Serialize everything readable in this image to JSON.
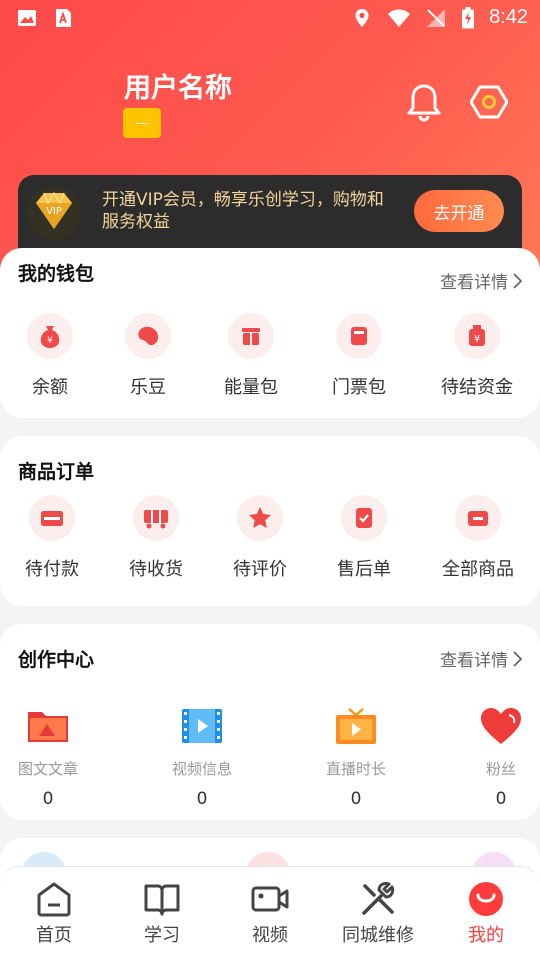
{
  "status_bar": {
    "time": "8:42"
  },
  "profile": {
    "username": "用户名称",
    "badge": "---"
  },
  "vip": {
    "gem_text": "VIP",
    "description": "开通VIP会员，畅享乐创学习，购物和服务权益",
    "button": "去开通"
  },
  "wallet": {
    "title": "我的钱包",
    "detail": "查看详情",
    "items": [
      {
        "label": "余额",
        "icon": "money-bag-icon"
      },
      {
        "label": "乐豆",
        "icon": "bean-icon"
      },
      {
        "label": "能量包",
        "icon": "gift-box-icon"
      },
      {
        "label": "门票包",
        "icon": "ticket-icon"
      },
      {
        "label": "待结资金",
        "icon": "pending-funds-icon"
      }
    ]
  },
  "orders": {
    "title": "商品订单",
    "items": [
      {
        "label": "待付款",
        "icon": "card-icon"
      },
      {
        "label": "待收货",
        "icon": "truck-icon"
      },
      {
        "label": "待评价",
        "icon": "star-icon"
      },
      {
        "label": "售后单",
        "icon": "shield-icon"
      },
      {
        "label": "全部商品",
        "icon": "wallet-icon"
      }
    ]
  },
  "creation": {
    "title": "创作中心",
    "detail": "查看详情",
    "items": [
      {
        "label": "图文文章",
        "count": "0",
        "icon": "folder-icon"
      },
      {
        "label": "视频信息",
        "count": "0",
        "icon": "film-icon"
      },
      {
        "label": "直播时长",
        "count": "0",
        "icon": "tv-icon"
      },
      {
        "label": "粉丝",
        "count": "0",
        "icon": "heart-icon"
      }
    ]
  },
  "bottom_nav": [
    {
      "label": "首页",
      "icon": "home-icon"
    },
    {
      "label": "学习",
      "icon": "book-icon"
    },
    {
      "label": "视频",
      "icon": "video-camera-icon"
    },
    {
      "label": "同城维修",
      "icon": "tools-icon"
    },
    {
      "label": "我的",
      "icon": "profile-smile-icon",
      "active": true
    }
  ],
  "colors": {
    "brand_red": "#ff4a4a",
    "vip_gold": "#f3d59a",
    "badge_yellow": "#ffc400"
  }
}
